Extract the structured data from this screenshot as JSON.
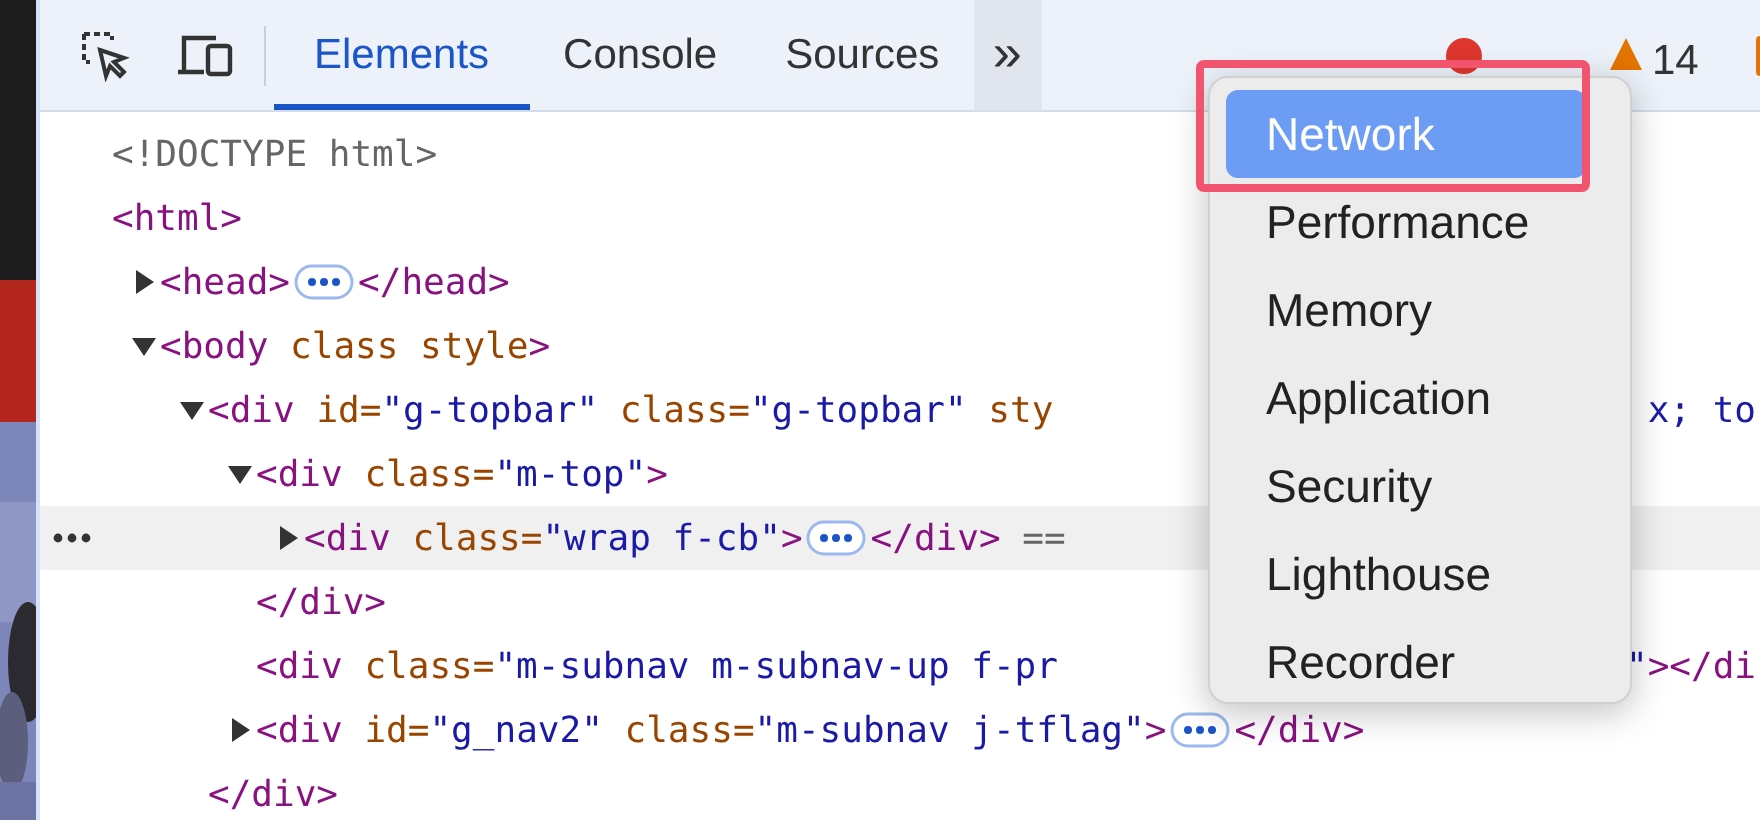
{
  "toolbar": {
    "tabs": [
      {
        "label": "Elements",
        "selected": true
      },
      {
        "label": "Console",
        "selected": false
      },
      {
        "label": "Sources",
        "selected": false
      }
    ],
    "more_tabs": "»",
    "warnings": "14"
  },
  "dom_tree": [
    {
      "selected": false,
      "tokens": [
        {
          "kind": "plain",
          "text": "<!DOCTYPE html>"
        }
      ]
    },
    {
      "selected": false,
      "tokens": [
        {
          "kind": "tag",
          "text": "<html>"
        }
      ],
      "children": [
        {
          "expanded": false,
          "selected": false,
          "tokens": [
            {
              "kind": "tag",
              "text": "<head>"
            },
            {
              "kind": "ellipsis"
            },
            {
              "kind": "tag",
              "text": "</head>"
            }
          ]
        },
        {
          "expanded": true,
          "selected": false,
          "tokens": [
            {
              "kind": "tag",
              "text": "<body"
            },
            {
              "kind": "attr",
              "text": " class style"
            },
            {
              "kind": "tag",
              "text": ">"
            }
          ],
          "children": [
            {
              "expanded": true,
              "selected": false,
              "tokens": [
                {
                  "kind": "tag",
                  "text": "<div"
                },
                {
                  "kind": "attr",
                  "text": " id="
                },
                {
                  "kind": "value",
                  "text": "\"g-topbar\""
                },
                {
                  "kind": "attr",
                  "text": " class="
                },
                {
                  "kind": "value",
                  "text": "\"g-topbar\""
                },
                {
                  "kind": "attr",
                  "text": " sty"
                }
              ],
              "tail": [
                {
                  "kind": "value",
                  "text": "x; to"
                }
              ],
              "children": [
                {
                  "expanded": true,
                  "selected": false,
                  "tokens": [
                    {
                      "kind": "tag",
                      "text": "<div"
                    },
                    {
                      "kind": "attr",
                      "text": " class="
                    },
                    {
                      "kind": "value",
                      "text": "\"m-top\""
                    },
                    {
                      "kind": "tag",
                      "text": ">"
                    }
                  ],
                  "children": [
                    {
                      "expanded": false,
                      "selected": true,
                      "tokens": [
                        {
                          "kind": "tag",
                          "text": "<div"
                        },
                        {
                          "kind": "attr",
                          "text": " class="
                        },
                        {
                          "kind": "value",
                          "text": "\"wrap f-cb\""
                        },
                        {
                          "kind": "tag",
                          "text": ">"
                        },
                        {
                          "kind": "ellipsis"
                        },
                        {
                          "kind": "tag",
                          "text": "</div>"
                        },
                        {
                          "kind": "plain",
                          "text": " =="
                        }
                      ]
                    }
                  ]
                },
                {
                  "selected": false,
                  "tokens": [
                    {
                      "kind": "tag",
                      "text": "</div>"
                    }
                  ]
                },
                {
                  "selected": false,
                  "tokens": [
                    {
                      "kind": "tag",
                      "text": "<div"
                    },
                    {
                      "kind": "attr",
                      "text": " class="
                    },
                    {
                      "kind": "value",
                      "text": "\"m-subnav m-subnav-up f-pr"
                    }
                  ],
                  "tail": [
                    {
                      "kind": "value",
                      "text": "\""
                    },
                    {
                      "kind": "tag",
                      "text": "></di"
                    }
                  ]
                },
                {
                  "expanded": false,
                  "selected": false,
                  "tokens": [
                    {
                      "kind": "tag",
                      "text": "<div"
                    },
                    {
                      "kind": "attr",
                      "text": " id="
                    },
                    {
                      "kind": "value",
                      "text": "\"g_nav2\""
                    },
                    {
                      "kind": "attr",
                      "text": " class="
                    },
                    {
                      "kind": "value",
                      "text": "\"m-subnav j-tflag\""
                    },
                    {
                      "kind": "tag",
                      "text": ">"
                    },
                    {
                      "kind": "ellipsis"
                    },
                    {
                      "kind": "tag",
                      "text": "</div>"
                    }
                  ]
                }
              ]
            },
            {
              "selected": false,
              "tokens": [
                {
                  "kind": "tag",
                  "text": "</div>"
                }
              ]
            }
          ]
        }
      ]
    }
  ],
  "menu": {
    "items": [
      {
        "label": "Network",
        "selected": true
      },
      {
        "label": "Performance",
        "selected": false
      },
      {
        "label": "Memory",
        "selected": false
      },
      {
        "label": "Application",
        "selected": false
      },
      {
        "label": "Security",
        "selected": false
      },
      {
        "label": "Lighthouse",
        "selected": false
      },
      {
        "label": "Recorder",
        "selected": false
      }
    ]
  }
}
